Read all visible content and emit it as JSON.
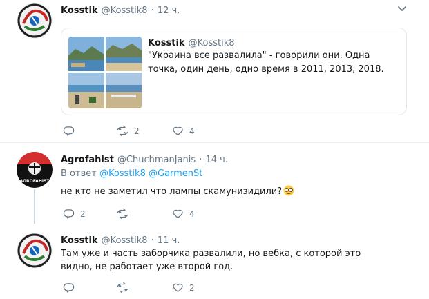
{
  "tweets": [
    {
      "name": "Kosstik",
      "handle": "@Kosstik8",
      "time": "12 ч.",
      "quote": {
        "name": "Kosstik",
        "handle": "@Kosstik8",
        "text": "\"Украина все развалила\" - говорили они. Одна точка, один день, одно время в 2011, 2013, 2018."
      },
      "actions": {
        "reply": "",
        "retweet": "2",
        "like": "4"
      }
    },
    {
      "name": "Agrofahist",
      "handle": "@ChuchmanJanis",
      "time": "14 ч.",
      "reply_prefix": "В ответ",
      "reply_users": [
        "@Kosstik8",
        "@GarmenSt"
      ],
      "text": "не кто не заметил что лампы скамунизидили?",
      "avatar_text": "AGROFAHIST",
      "actions": {
        "reply": "2",
        "retweet": "",
        "like": "4"
      }
    },
    {
      "name": "Kosstik",
      "handle": "@Kosstik8",
      "time": "11 ч.",
      "text": "Там уже и часть заборчика развалили, но вебка, с которой это видно, не работает уже второй год.",
      "actions": {
        "reply": "",
        "retweet": "",
        "like": "2"
      }
    }
  ],
  "separator": "·",
  "icons": [
    "reply-icon",
    "retweet-icon",
    "like-icon",
    "chevron-down-icon",
    "nerd-face-emoji"
  ]
}
